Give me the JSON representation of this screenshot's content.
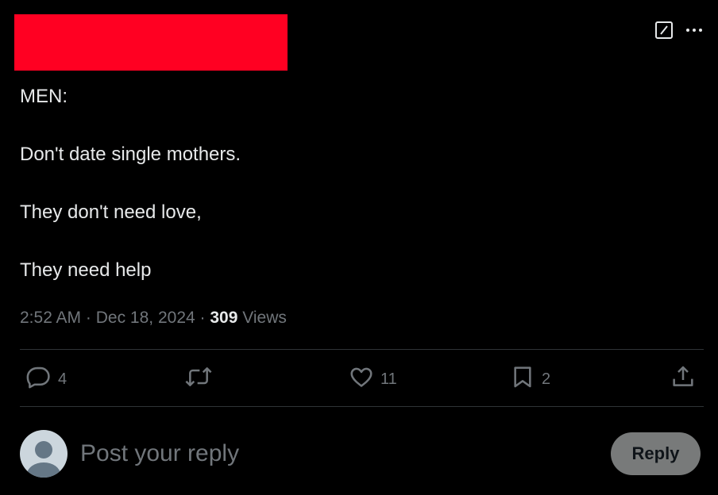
{
  "tweet": {
    "lines": [
      "MEN:",
      "Don't date single mothers.",
      "They don't need love,",
      "They need help"
    ],
    "time": "2:52 AM",
    "date": "Dec 18, 2024",
    "separator": "·",
    "views_count": "309",
    "views_label": "Views"
  },
  "actions": {
    "replies": "4",
    "likes": "11",
    "bookmarks": "2"
  },
  "reply_box": {
    "placeholder": "Post your reply",
    "button_label": "Reply"
  },
  "colors": {
    "background": "#000000",
    "text": "#e7e9ea",
    "muted": "#71767b",
    "redaction": "#ff0022",
    "reply_button": "#787a7a"
  },
  "icons": {
    "top": [
      "grok-icon",
      "more-icon"
    ],
    "actions": [
      "reply-icon",
      "retweet-icon",
      "like-icon",
      "bookmark-icon",
      "share-icon"
    ]
  }
}
